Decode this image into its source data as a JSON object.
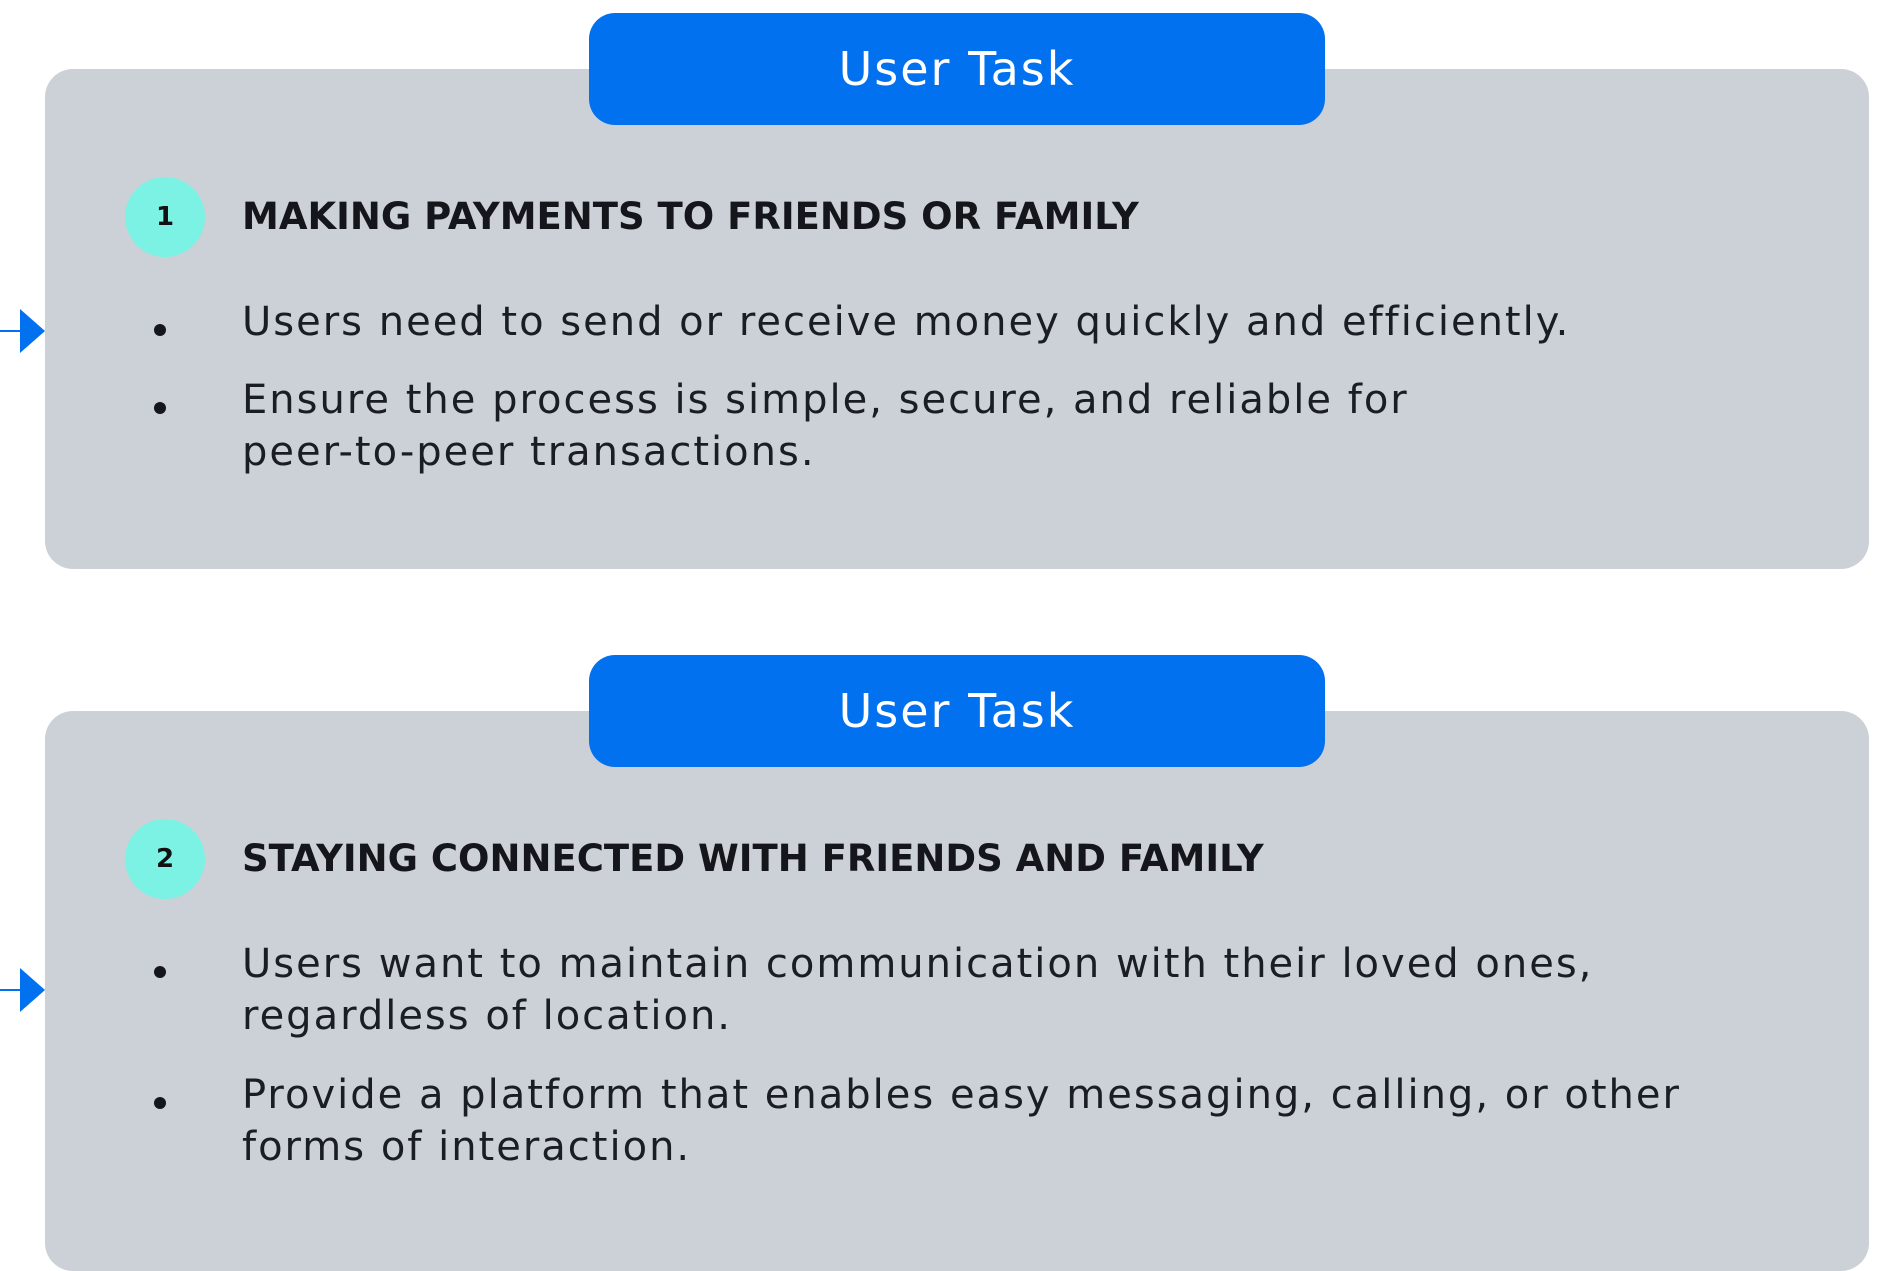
{
  "colors": {
    "card_background": "#cbd1d7",
    "pill_background": "#0171ef",
    "pill_text": "#ffffff",
    "badge_background": "#7bf2e3",
    "heading_text": "#14161b",
    "connector": "#0171ef"
  },
  "tasks": [
    {
      "label": "User Task",
      "number": "1",
      "title": "MAKING PAYMENTS TO FRIENDS OR FAMILY",
      "bullets": [
        "Users need to send or receive money quickly and efficiently.",
        "Ensure the process is simple, secure, and reliable for peer-to-peer transactions."
      ]
    },
    {
      "label": "User Task",
      "number": "2",
      "title": "STAYING CONNECTED WITH FRIENDS AND FAMILY",
      "bullets": [
        "Users want to maintain communication with their loved ones, regardless of location.",
        "Provide a platform that enables easy messaging, calling, or other forms of interaction."
      ]
    }
  ]
}
